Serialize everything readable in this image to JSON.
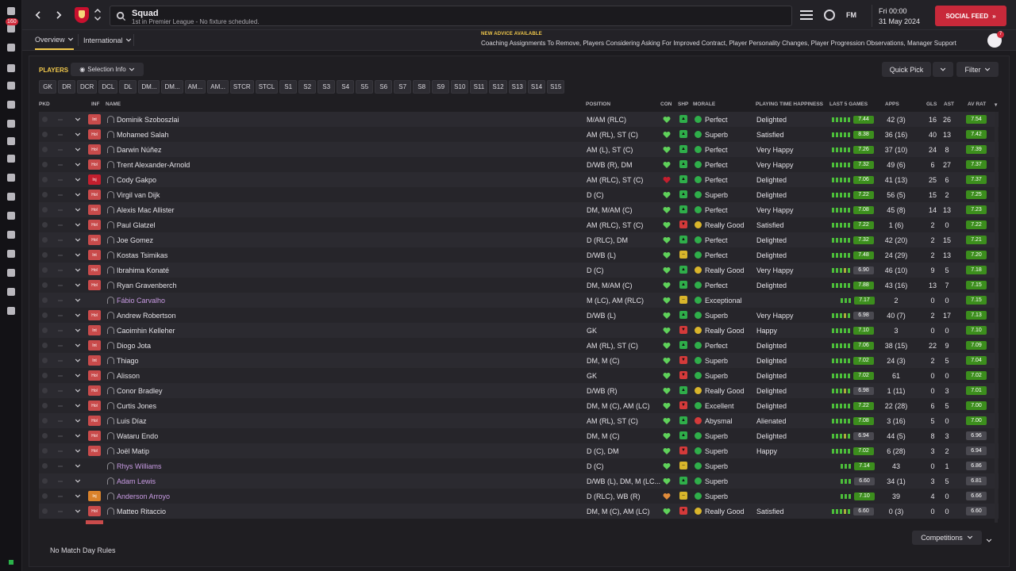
{
  "header": {
    "title": "Squad",
    "subtitle": "1st in Premier League - No fixture scheduled.",
    "brand": "FM",
    "day_time": "Fri 00:00",
    "date": "31 May 2024",
    "social_feed": "SOCIAL FEED"
  },
  "rail": {
    "inbox_badge": "160",
    "icons": [
      "home-icon",
      "inbox-icon",
      "squad-icon",
      "dynamics-icon",
      "staff-icon",
      "training-icon",
      "medical-icon",
      "tactics-icon",
      "data-hub-icon",
      "schedule-icon",
      "competitions-icon",
      "scouting-icon",
      "transfers-icon",
      "club-info-icon",
      "club-vision-icon",
      "finances-icon",
      "dev-centre-icon"
    ]
  },
  "subnav": {
    "tab_overview": "Overview",
    "tab_international": "International",
    "advice_heading": "NEW ADVICE AVAILABLE",
    "advice_text": "Coaching Assignments To Remove, Players Considering Asking For Improved Contract, Player Personality Changes, Player Progression Observations, Manager Support",
    "notif_count": "7"
  },
  "toolbar": {
    "players_label": "PLAYERS",
    "selection_info": "Selection Info",
    "quick_pick": "Quick Pick",
    "filter": "Filter"
  },
  "position_tabs": [
    "GK",
    "DR",
    "DCR",
    "DCL",
    "DL",
    "DM...",
    "DM...",
    "AM...",
    "AM...",
    "STCR",
    "STCL",
    "S1",
    "S2",
    "S3",
    "S4",
    "S5",
    "S6",
    "S7",
    "S8",
    "S9",
    "S10",
    "S11",
    "S12",
    "S13",
    "S14",
    "S15"
  ],
  "columns": {
    "pkd": "PKD",
    "inf": "INF",
    "name": "NAME",
    "position": "POSITION",
    "con": "CON",
    "shp": "SHP",
    "morale": "MORALE",
    "pth": "PLAYING TIME HAPPINESS",
    "last5": "LAST 5 GAMES",
    "apps": "APPS",
    "gls": "GLS",
    "ast": "AST",
    "avrat": "AV RAT"
  },
  "players": [
    {
      "inf": "Int",
      "name": "Dominik Szoboszlai",
      "position": "M/AM (RLC)",
      "shp": "up",
      "morale": "Perfect",
      "pth": "Delighted",
      "last5": "7.44",
      "apps": "42 (3)",
      "gls": "16",
      "ast": "26",
      "avrat": "7.54"
    },
    {
      "inf": "Hol",
      "name": "Mohamed Salah",
      "position": "AM (RL), ST (C)",
      "shp": "up",
      "morale": "Superb",
      "pth": "Satisfied",
      "last5": "8.38",
      "apps": "36 (16)",
      "gls": "40",
      "ast": "13",
      "avrat": "7.42"
    },
    {
      "inf": "Hol",
      "name": "Darwin Núñez",
      "position": "AM (L), ST (C)",
      "shp": "up",
      "morale": "Perfect",
      "pth": "Very Happy",
      "last5": "7.26",
      "apps": "37 (10)",
      "gls": "24",
      "ast": "8",
      "avrat": "7.39"
    },
    {
      "inf": "Hol",
      "name": "Trent Alexander-Arnold",
      "position": "D/WB (R), DM",
      "shp": "up",
      "morale": "Perfect",
      "pth": "Very Happy",
      "last5": "7.32",
      "apps": "49 (6)",
      "gls": "6",
      "ast": "27",
      "avrat": "7.37"
    },
    {
      "inf": "Inj",
      "name": "Cody Gakpo",
      "position": "AM (RLC), ST (C)",
      "shp": "up",
      "morale": "Perfect",
      "pth": "Delighted",
      "last5": "7.06",
      "apps": "41 (13)",
      "gls": "25",
      "ast": "6",
      "avrat": "7.37"
    },
    {
      "inf": "Hol",
      "name": "Virgil van Dijk",
      "position": "D (C)",
      "shp": "up",
      "morale": "Superb",
      "pth": "Delighted",
      "last5": "7.22",
      "apps": "56 (5)",
      "gls": "15",
      "ast": "2",
      "avrat": "7.25"
    },
    {
      "inf": "Hol",
      "name": "Alexis Mac Allister",
      "position": "DM, M/AM (C)",
      "shp": "up",
      "morale": "Perfect",
      "pth": "Very Happy",
      "last5": "7.08",
      "apps": "45 (8)",
      "gls": "14",
      "ast": "13",
      "avrat": "7.23"
    },
    {
      "inf": "Hol",
      "name": "Paul Glatzel",
      "position": "AM (RLC), ST (C)",
      "shp": "down",
      "morale": "Really Good",
      "pth": "Satisfied",
      "last5": "7.22",
      "apps": "1 (6)",
      "gls": "2",
      "ast": "0",
      "avrat": "7.22"
    },
    {
      "inf": "Hol",
      "name": "Joe Gomez",
      "position": "D (RLC), DM",
      "shp": "up",
      "morale": "Perfect",
      "pth": "Delighted",
      "last5": "7.32",
      "apps": "42 (20)",
      "gls": "2",
      "ast": "15",
      "avrat": "7.21"
    },
    {
      "inf": "Int",
      "name": "Kostas Tsimikas",
      "position": "D/WB (L)",
      "shp": "mid",
      "morale": "Perfect",
      "pth": "Delighted",
      "last5": "7.48",
      "apps": "24 (29)",
      "gls": "2",
      "ast": "13",
      "avrat": "7.20"
    },
    {
      "inf": "Hol",
      "name": "Ibrahima Konaté",
      "position": "D (C)",
      "shp": "up",
      "morale": "Really Good",
      "pth": "Very Happy",
      "last5": "6.90",
      "apps": "46 (10)",
      "gls": "9",
      "ast": "5",
      "avrat": "7.18"
    },
    {
      "inf": "Hol",
      "name": "Ryan Gravenberch",
      "position": "DM, M/AM (C)",
      "shp": "up",
      "morale": "Perfect",
      "pth": "Delighted",
      "last5": "7.88",
      "apps": "43 (16)",
      "gls": "13",
      "ast": "7",
      "avrat": "7.15"
    },
    {
      "inf": "",
      "loan": true,
      "name": "Fábio Carvalho",
      "position": "M (LC), AM (RLC)",
      "shp": "mid",
      "morale": "Exceptional",
      "pth": "",
      "last5": "7.17",
      "apps": "2",
      "gls": "0",
      "ast": "0",
      "avrat": "7.15"
    },
    {
      "inf": "Hol",
      "name": "Andrew Robertson",
      "position": "D/WB (L)",
      "shp": "up",
      "morale": "Superb",
      "pth": "Very Happy",
      "last5": "6.98",
      "apps": "40 (7)",
      "gls": "2",
      "ast": "17",
      "avrat": "7.13"
    },
    {
      "inf": "Int",
      "name": "Caoimhin Kelleher",
      "position": "GK",
      "shp": "down",
      "morale": "Really Good",
      "pth": "Happy",
      "last5": "7.10",
      "apps": "3",
      "gls": "0",
      "ast": "0",
      "avrat": "7.10"
    },
    {
      "inf": "Int",
      "name": "Diogo Jota",
      "position": "AM (RL), ST (C)",
      "shp": "up",
      "morale": "Perfect",
      "pth": "Delighted",
      "last5": "7.06",
      "apps": "38 (15)",
      "gls": "22",
      "ast": "9",
      "avrat": "7.09"
    },
    {
      "inf": "Int",
      "name": "Thiago",
      "position": "DM, M (C)",
      "shp": "down",
      "morale": "Superb",
      "pth": "Delighted",
      "last5": "7.02",
      "apps": "24 (3)",
      "gls": "2",
      "ast": "5",
      "avrat": "7.04"
    },
    {
      "inf": "Hol",
      "name": "Alisson",
      "position": "GK",
      "shp": "down",
      "morale": "Superb",
      "pth": "Delighted",
      "last5": "7.02",
      "apps": "61",
      "gls": "0",
      "ast": "0",
      "avrat": "7.02"
    },
    {
      "inf": "Hol",
      "name": "Conor Bradley",
      "position": "D/WB (R)",
      "shp": "up",
      "morale": "Really Good",
      "pth": "Delighted",
      "last5": "6.98",
      "apps": "1 (11)",
      "gls": "0",
      "ast": "3",
      "avrat": "7.01"
    },
    {
      "inf": "Hol",
      "name": "Curtis Jones",
      "position": "DM, M (C), AM (LC)",
      "shp": "down",
      "morale": "Excellent",
      "pth": "Delighted",
      "last5": "7.22",
      "apps": "22 (28)",
      "gls": "6",
      "ast": "5",
      "avrat": "7.00"
    },
    {
      "inf": "Hol",
      "name": "Luis Díaz",
      "position": "AM (RL), ST (C)",
      "shp": "up",
      "morale": "Abysmal",
      "pth": "Alienated",
      "last5": "7.08",
      "apps": "3 (16)",
      "gls": "5",
      "ast": "0",
      "avrat": "7.00"
    },
    {
      "inf": "Hol",
      "name": "Wataru Endo",
      "position": "DM, M (C)",
      "shp": "up",
      "morale": "Superb",
      "pth": "Delighted",
      "last5": "6.94",
      "apps": "44 (5)",
      "gls": "8",
      "ast": "3",
      "avrat": "6.96"
    },
    {
      "inf": "Hol",
      "name": "Joël Matip",
      "position": "D (C), DM",
      "shp": "down",
      "morale": "Superb",
      "pth": "Happy",
      "last5": "7.02",
      "apps": "6 (28)",
      "gls": "3",
      "ast": "2",
      "avrat": "6.94"
    },
    {
      "inf": "",
      "loan": true,
      "name": "Rhys Williams",
      "position": "D (C)",
      "shp": "mid",
      "morale": "Superb",
      "pth": "",
      "last5": "7.14",
      "apps": "43",
      "gls": "0",
      "ast": "1",
      "avrat": "6.86"
    },
    {
      "inf": "",
      "loan": true,
      "name": "Adam Lewis",
      "position": "D/WB (L), DM, M (LC...",
      "shp": "up",
      "morale": "Superb",
      "pth": "",
      "last5": "6.60",
      "apps": "34 (1)",
      "gls": "3",
      "ast": "5",
      "avrat": "6.81"
    },
    {
      "inf": "Inj",
      "loan": true,
      "name": "Anderson Arroyo",
      "position": "D (RLC), WB (R)",
      "shp": "mid",
      "morale": "Superb",
      "pth": "",
      "last5": "7.10",
      "apps": "39",
      "gls": "4",
      "ast": "0",
      "avrat": "6.66"
    },
    {
      "inf": "Hol",
      "name": "Matteo Ritaccio",
      "position": "DM, M (C), AM (LC)",
      "shp": "down",
      "morale": "Really Good",
      "pth": "Satisfied",
      "last5": "6.60",
      "apps": "0 (3)",
      "gls": "0",
      "ast": "0",
      "avrat": "6.60"
    }
  ],
  "footer": {
    "competitions": "Competitions",
    "no_match_day_rules": "No Match Day Rules"
  },
  "colors": {
    "accent_yellow": "#f2c94c",
    "social_red": "#c8293a",
    "rating_green": "#3c8e1d",
    "rating_dark": "#4a4950",
    "loan_purple": "#c89be3"
  }
}
